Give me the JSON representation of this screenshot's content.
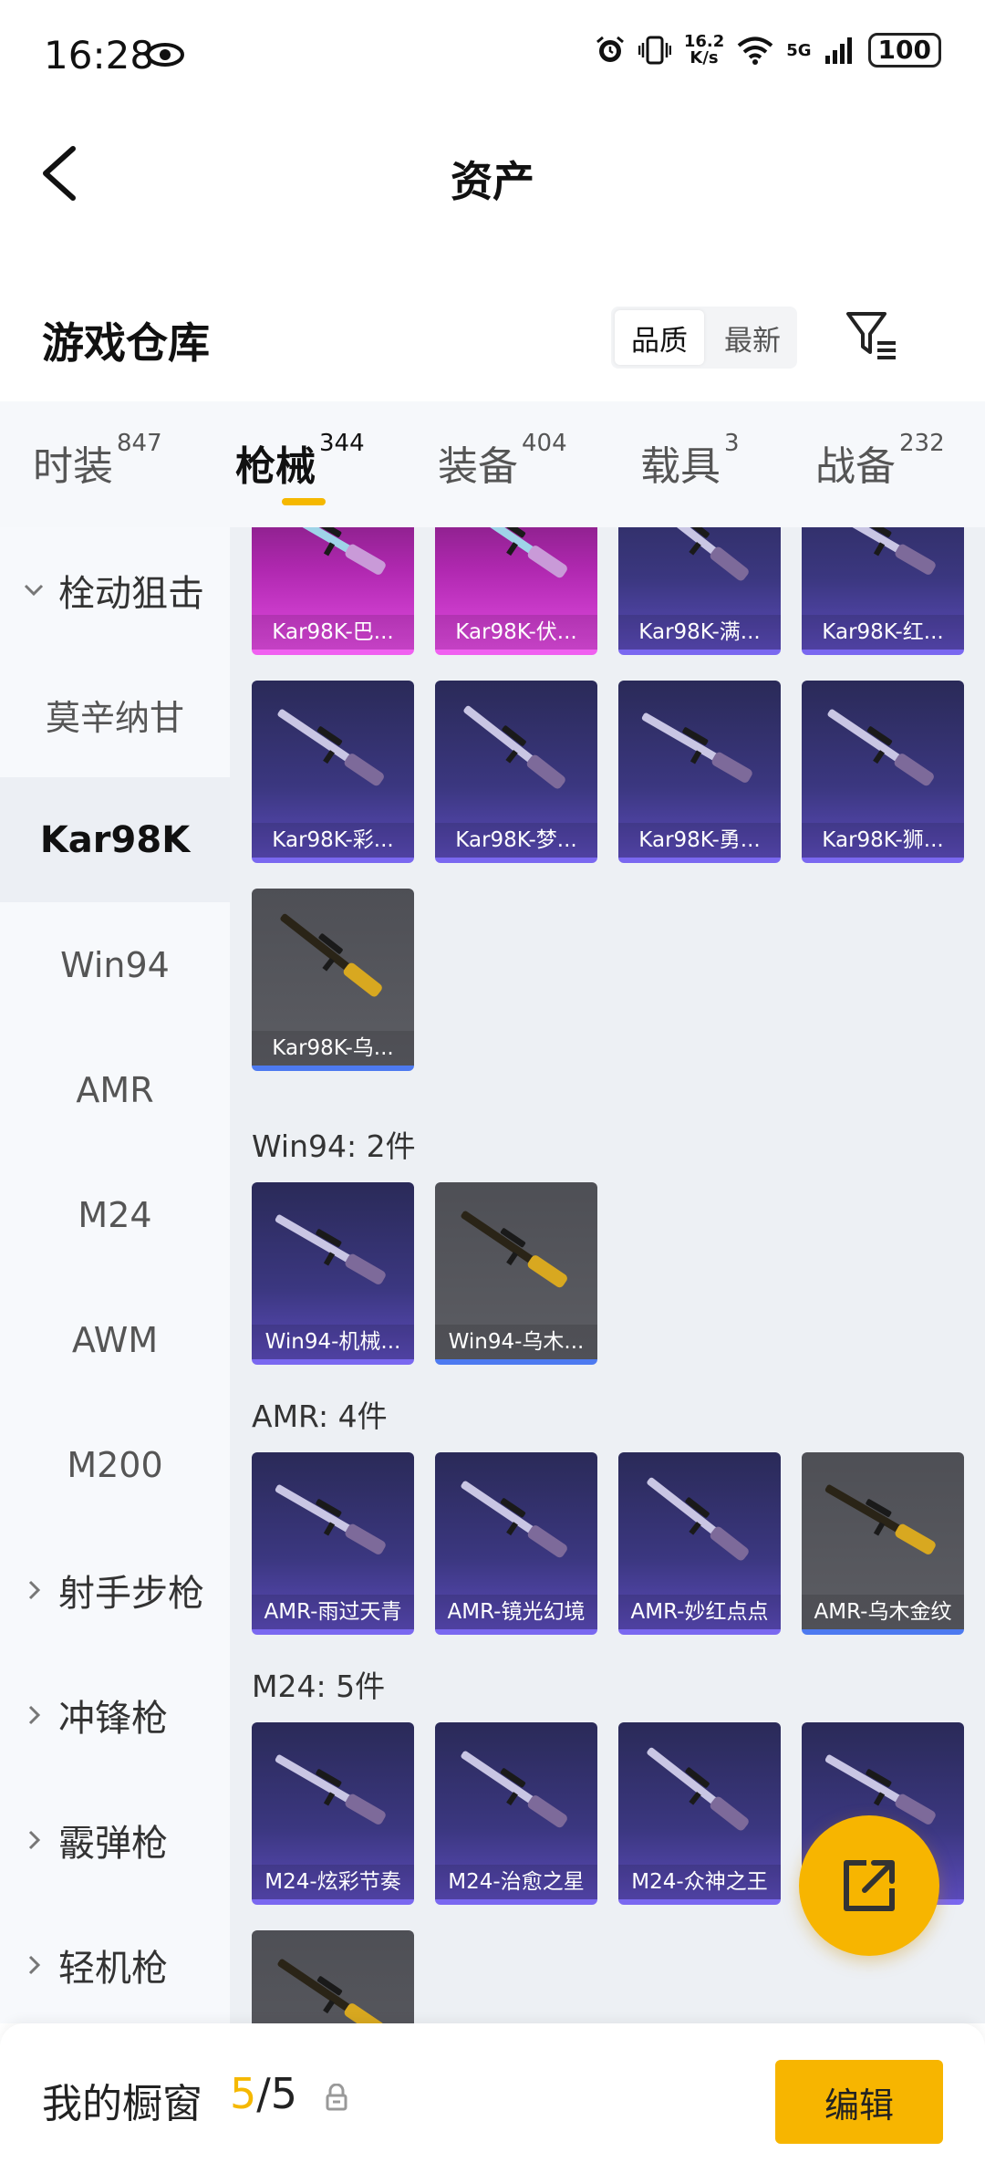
{
  "status_bar": {
    "time": "16:28",
    "net_speed_value": "16.2",
    "net_speed_unit": "K/s",
    "network": "5G",
    "battery": "100",
    "icons": [
      "eye-icon",
      "alarm-icon",
      "vibrate-icon",
      "wifi-icon",
      "signal-icon",
      "battery-icon"
    ]
  },
  "header": {
    "title": "资产",
    "back_icon": "chevron-left-icon"
  },
  "warehouse": {
    "title": "游戏仓库",
    "sort_options": [
      "品质",
      "最新"
    ],
    "selected_sort": "品质",
    "filter_icon": "filter-icon"
  },
  "tabs": [
    {
      "label": "时装",
      "count": "847"
    },
    {
      "label": "枪械",
      "count": "344"
    },
    {
      "label": "装备",
      "count": "404"
    },
    {
      "label": "载具",
      "count": "3"
    },
    {
      "label": "战备",
      "count": "232"
    }
  ],
  "active_tab": "枪械",
  "sidebar": {
    "items": [
      {
        "label": "栓动狙击",
        "kind": "group-expanded"
      },
      {
        "label": "莫辛纳甘",
        "kind": "sub"
      },
      {
        "label": "Kar98K",
        "kind": "sub-selected"
      },
      {
        "label": "Win94",
        "kind": "sub"
      },
      {
        "label": "AMR",
        "kind": "sub"
      },
      {
        "label": "M24",
        "kind": "sub"
      },
      {
        "label": "AWM",
        "kind": "sub"
      },
      {
        "label": "M200",
        "kind": "sub"
      },
      {
        "label": "射手步枪",
        "kind": "group"
      },
      {
        "label": "冲锋枪",
        "kind": "group"
      },
      {
        "label": "霰弹枪",
        "kind": "group"
      },
      {
        "label": "轻机枪",
        "kind": "group"
      }
    ]
  },
  "sections": {
    "kar98k": {
      "items": [
        {
          "name": "Kar98K-巴...",
          "rarity": "pink"
        },
        {
          "name": "Kar98K-伏...",
          "rarity": "pink"
        },
        {
          "name": "Kar98K-满...",
          "rarity": "purple"
        },
        {
          "name": "Kar98K-红...",
          "rarity": "purple"
        },
        {
          "name": "Kar98K-彩...",
          "rarity": "purple"
        },
        {
          "name": "Kar98K-梦...",
          "rarity": "purple"
        },
        {
          "name": "Kar98K-勇...",
          "rarity": "purple"
        },
        {
          "name": "Kar98K-狮...",
          "rarity": "purple"
        },
        {
          "name": "Kar98K-乌...",
          "rarity": "gray"
        }
      ]
    },
    "win94": {
      "title": "Win94: 2件",
      "items": [
        {
          "name": "Win94-机械...",
          "rarity": "purple"
        },
        {
          "name": "Win94-乌木...",
          "rarity": "gray"
        }
      ]
    },
    "amr": {
      "title": "AMR: 4件",
      "items": [
        {
          "name": "AMR-雨过天青",
          "rarity": "purple"
        },
        {
          "name": "AMR-镜光幻境",
          "rarity": "purple"
        },
        {
          "name": "AMR-妙红点点",
          "rarity": "purple"
        },
        {
          "name": "AMR-乌木金纹",
          "rarity": "gray"
        }
      ]
    },
    "m24": {
      "title": "M24: 5件",
      "items": [
        {
          "name": "M24-炫彩节奏",
          "rarity": "purple"
        },
        {
          "name": "M24-治愈之星",
          "rarity": "purple"
        },
        {
          "name": "M24-众神之王",
          "rarity": "purple"
        },
        {
          "name": "",
          "rarity": "purple"
        },
        {
          "name": "",
          "rarity": "gray"
        }
      ]
    }
  },
  "share_button": {
    "icon": "share-external-icon"
  },
  "showcase": {
    "label": "我的橱窗",
    "used": "5",
    "separator": "/",
    "total": "5",
    "lock_icon": "lock-icon",
    "edit_label": "编辑"
  },
  "colors": {
    "accent": "#f7b500",
    "rarity_purple": "#5a4ab8",
    "rarity_pink": "#e04ae0",
    "rarity_gray": "#5c5d63",
    "sidebar_bg": "#f7f9fc",
    "content_bg": "#edf0f4"
  }
}
